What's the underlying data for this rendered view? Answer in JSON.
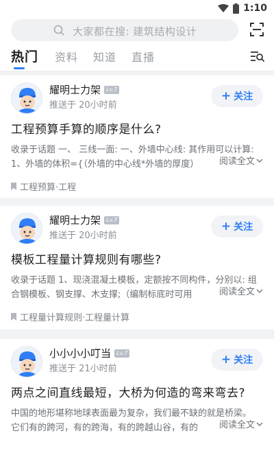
{
  "status": {
    "time": "1:10"
  },
  "search": {
    "placeholder": "大家都在搜: 建筑结构设计"
  },
  "tabs": [
    {
      "label": "热门"
    },
    {
      "label": "资料"
    },
    {
      "label": "知道"
    },
    {
      "label": "直播"
    }
  ],
  "colors": {
    "accent": "#2f7ef5",
    "page_bg": "#f2f3f5",
    "avatar_hair": "#2f7ef5"
  },
  "icons": {
    "wifi": "wifi-icon",
    "battery": "battery-icon",
    "search": "search-icon",
    "scan": "scan-icon",
    "filter": "list-search-icon",
    "tag": "bookmark-icon",
    "chevron": "chevron-down-icon",
    "avatar": "worker-avatar-icon"
  },
  "feed": [
    {
      "author": "耀明士力架",
      "level": "Lv.7",
      "time": "推送于 20小时前",
      "follow_label": "关注",
      "title": "工程预算手算的顺序是什么?",
      "excerpt": "收录于话题 一、 三线一面: 一、外墙中心线: 其作用可以计算: 1、外墙的体积={（外墙的中心线*外墙的厚度）",
      "read_more": "阅读全文",
      "tags": "工程预算·工程"
    },
    {
      "author": "耀明士力架",
      "level": "Lv.7",
      "time": "推送于 20小时前",
      "follow_label": "关注",
      "title": "模板工程量计算规则有哪些?",
      "excerpt": "收录于话题 1、现浇混凝土模板，定额按不同构件，分别以: 组合钢模板、钢支撑、木支撑;（编制标底时可用",
      "read_more": "阅读全文",
      "tags": "工程量计算规则·工程量计算"
    },
    {
      "author": "小小小小叮当",
      "level": "Lv.7",
      "time": "推送于 21小时前",
      "follow_label": "关注",
      "title": "两点之间直线最短，大桥为何造的弯来弯去?",
      "excerpt": "中国的地形堪称地球表面最为复杂，我们最不缺的就是桥梁。 它们有的跨河，有的跨海，有的跨越山谷，有的",
      "read_more": "阅读全文",
      "tags": ""
    }
  ]
}
